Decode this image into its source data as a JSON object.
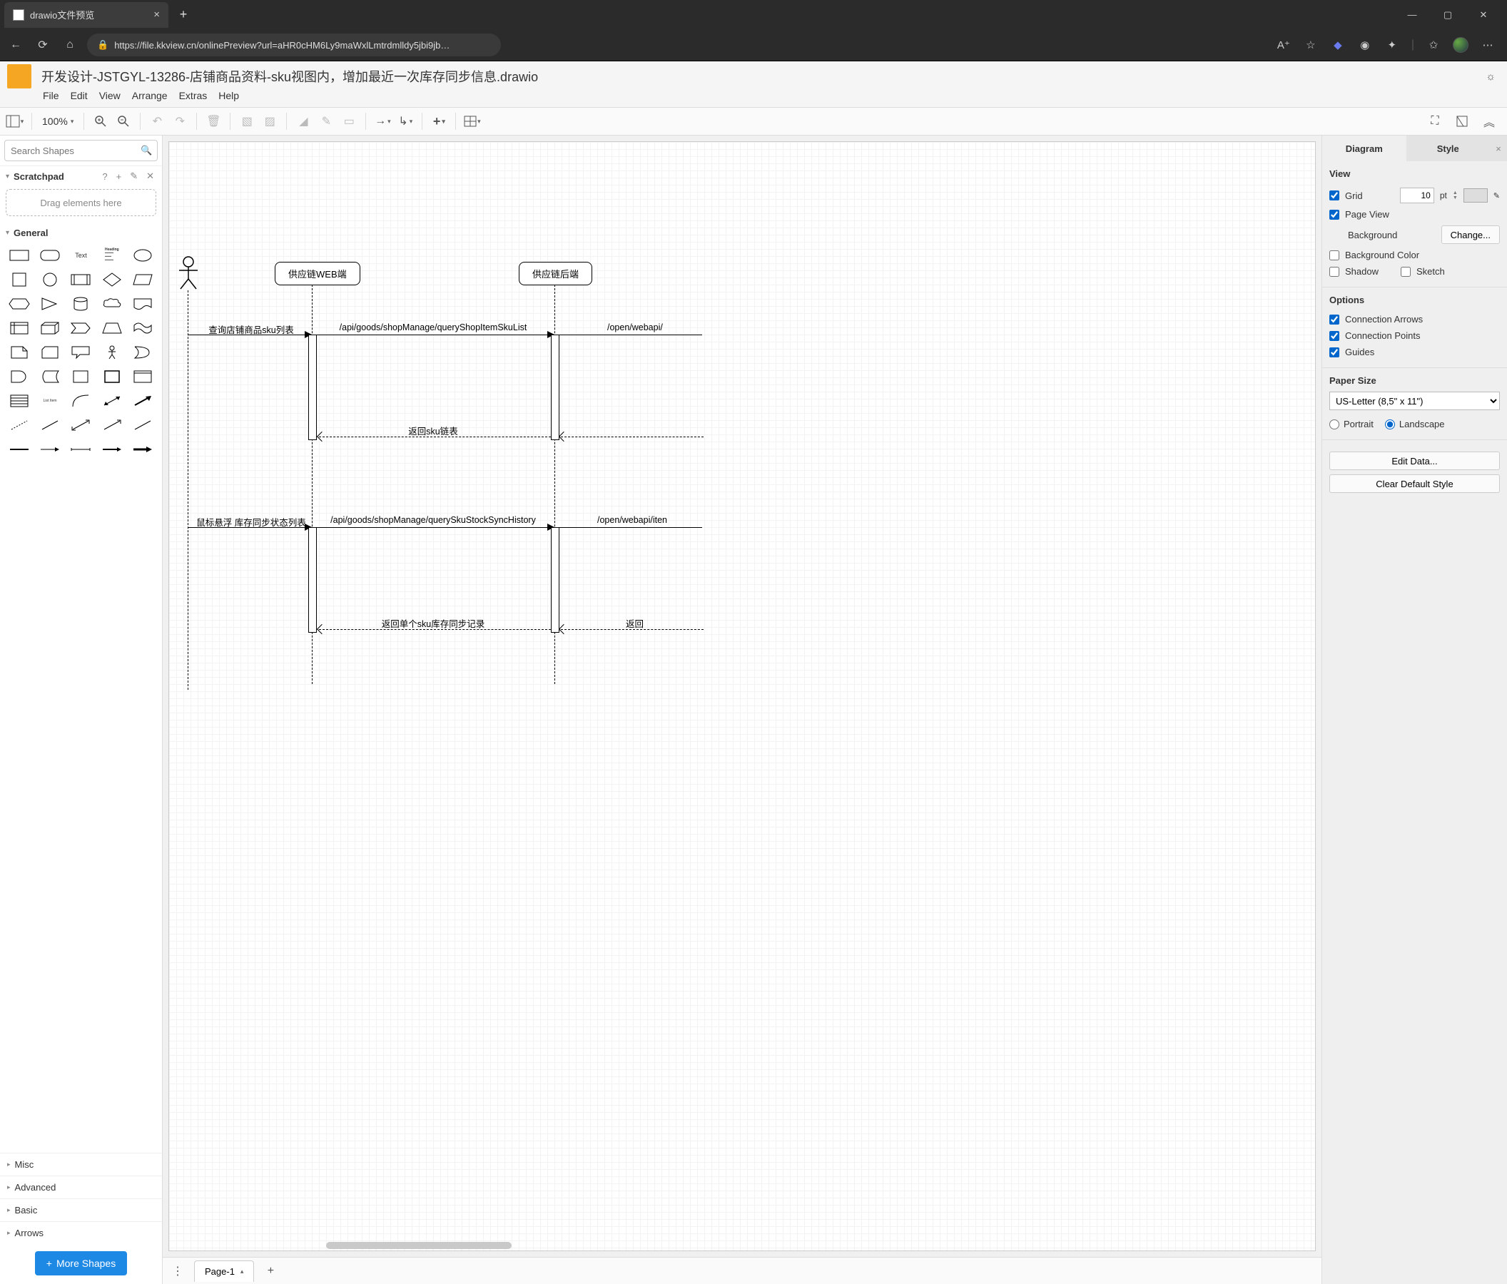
{
  "browser": {
    "tab_title": "drawio文件预览",
    "url_display": "https://file.kkview.cn/onlinePreview?url=aHR0cHM6Ly9maWxlLmtrdmlldy5jbi9jb…"
  },
  "app": {
    "doc_title": "开发设计-JSTGYL-13286-店铺商品资料-sku视图内，增加最近一次库存同步信息.drawio",
    "menu": {
      "file": "File",
      "edit": "Edit",
      "view": "View",
      "arrange": "Arrange",
      "extras": "Extras",
      "help": "Help"
    },
    "zoom": "100%"
  },
  "left": {
    "search_placeholder": "Search Shapes",
    "scratchpad": "Scratchpad",
    "scratch_hint": "Drag elements here",
    "general": "General",
    "text_label": "Text",
    "heading_label": "Heading",
    "list_item_label": "List Item",
    "misc": "Misc",
    "advanced": "Advanced",
    "basic": "Basic",
    "arrows": "Arrows",
    "more": "More Shapes"
  },
  "canvas": {
    "page1": "Page-1"
  },
  "diagram": {
    "labels": {
      "lane_web": "供应链WEB端",
      "lane_back": "供应链后端",
      "msg_query_sku_list": "查询店铺商品sku列表",
      "api_query_list": "/api/goods/shopManage/queryShopItemSkuList",
      "open_webapi_1": "/open/webapi/",
      "return_sku_chain": "返回sku链表",
      "msg_hover": "鼠标悬浮 库存同步状态列表",
      "api_history": "/api/goods/shopManage/querySkuStockSyncHistory",
      "open_webapi_item": "/open/webapi/iten",
      "return_single": "返回单个sku库存同步记录",
      "return_right": "返回"
    }
  },
  "right": {
    "tab_diagram": "Diagram",
    "tab_style": "Style",
    "view": "View",
    "grid": "Grid",
    "grid_value": "10",
    "grid_unit": "pt",
    "page_view": "Page View",
    "background": "Background",
    "change": "Change...",
    "bg_color": "Background Color",
    "shadow": "Shadow",
    "sketch": "Sketch",
    "options": "Options",
    "conn_arrows": "Connection Arrows",
    "conn_points": "Connection Points",
    "guides": "Guides",
    "paper": "Paper Size",
    "paper_value": "US-Letter (8,5\" x 11\")",
    "portrait": "Portrait",
    "landscape": "Landscape",
    "edit_data": "Edit Data...",
    "clear_style": "Clear Default Style"
  }
}
